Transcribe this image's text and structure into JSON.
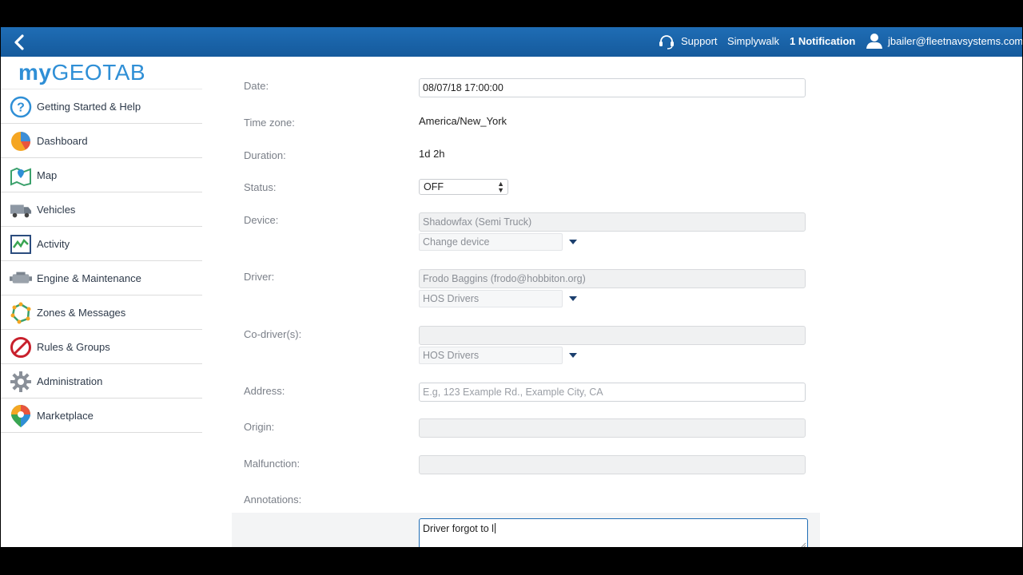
{
  "topbar": {
    "support": "Support",
    "company": "Simplywalk",
    "notification": "1 Notification",
    "user": "jbailer@fleetnavsystems.com"
  },
  "sidebar": {
    "logo_my": "my",
    "logo_geotab": "GEOTAB",
    "items": [
      {
        "label": "Getting Started & Help",
        "icon": "help-icon"
      },
      {
        "label": "Dashboard",
        "icon": "dashboard-icon"
      },
      {
        "label": "Map",
        "icon": "map-icon"
      },
      {
        "label": "Vehicles",
        "icon": "vehicles-icon"
      },
      {
        "label": "Activity",
        "icon": "activity-icon"
      },
      {
        "label": "Engine & Maintenance",
        "icon": "engine-icon"
      },
      {
        "label": "Zones & Messages",
        "icon": "zones-icon"
      },
      {
        "label": "Rules & Groups",
        "icon": "rules-icon"
      },
      {
        "label": "Administration",
        "icon": "gear-icon"
      },
      {
        "label": "Marketplace",
        "icon": "marketplace-icon"
      }
    ]
  },
  "form": {
    "date_label": "Date:",
    "date_value": "08/07/18 17:00:00",
    "timezone_label": "Time zone:",
    "timezone_value": "America/New_York",
    "duration_label": "Duration:",
    "duration_value": "1d 2h",
    "status_label": "Status:",
    "status_value": "OFF",
    "device_label": "Device:",
    "device_value": "Shadowfax (Semi Truck)",
    "device_change": "Change device",
    "driver_label": "Driver:",
    "driver_value": "Frodo Baggins (frodo@hobbiton.org)",
    "driver_group": "HOS Drivers",
    "codriver_label": "Co-driver(s):",
    "codriver_value": "",
    "codriver_group": "HOS Drivers",
    "address_label": "Address:",
    "address_placeholder": "E.g, 123 Example Rd., Example City, CA",
    "origin_label": "Origin:",
    "origin_value": "",
    "malfunction_label": "Malfunction:",
    "malfunction_value": "",
    "annotations_label": "Annotations:",
    "annotations_value": "Driver forgot to l"
  }
}
